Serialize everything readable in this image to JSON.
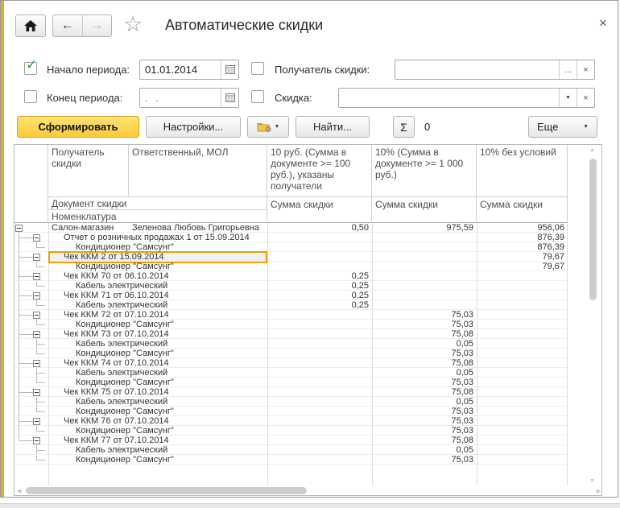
{
  "window": {
    "title": "Автоматические скидки"
  },
  "icons": {
    "check": "✓",
    "back": "←",
    "forward": "→",
    "star": "☆",
    "close": "×",
    "dropdown": "▼",
    "ellipsis": "...",
    "clear": "×",
    "sum": "Σ",
    "gear": "⚙",
    "up": "▲",
    "down": "▼",
    "left": "◀",
    "right": "▶"
  },
  "filters": {
    "start_period": {
      "label": "Начало периода:",
      "value": "01.01.2014",
      "checked": true
    },
    "end_period": {
      "label": "Конец периода:",
      "value": ". .",
      "checked": false
    },
    "recipient": {
      "label": "Получатель скидки:",
      "value": "",
      "checked": false
    },
    "discount": {
      "label": "Скидка:",
      "value": "",
      "checked": false
    }
  },
  "actions": {
    "generate": "Сформировать",
    "settings": "Настройки...",
    "find": "Найти...",
    "sum_value": "0",
    "more": "Еще"
  },
  "colors": {
    "accent_gold": "#dfae2e",
    "generate_button": "#fbca39",
    "selection_border": "#eaa300"
  },
  "table": {
    "header": {
      "col_recipient": "Получатель скидки",
      "col_responsible": "Ответственный, МОЛ",
      "col_10rub": "10 руб. (Сумма в документе >= 100 руб.), указаны получатели",
      "col_10pct": "10% (Сумма в документе >= 1 000 руб.)",
      "col_10nocond": "10% без условий",
      "row_document": "Документ скидки",
      "row_nomenclature": "Номенклатура",
      "sum_label": "Сумма скидки"
    },
    "rows": [
      {
        "level": 1,
        "expander": true,
        "label": "Салон-магазин",
        "responsible": "Зеленова Любовь Григорьевна",
        "v10rub": "0,50",
        "v10pct": "975,59",
        "v10nocond": "956,06"
      },
      {
        "level": 2,
        "expander": true,
        "label": "Отчет о розничных продажах 1 от 15.09.2014",
        "v10nocond": "876,39"
      },
      {
        "level": 3,
        "expander": false,
        "label": "Кондиционер \"Самсунг\"",
        "v10nocond": "876,39"
      },
      {
        "level": 2,
        "expander": true,
        "selected": true,
        "label": "Чек ККМ 2 от 15.09.2014",
        "v10nocond": "79,67"
      },
      {
        "level": 3,
        "expander": false,
        "label": "Кондиционер \"Самсунг\"",
        "v10nocond": "79,67"
      },
      {
        "level": 2,
        "expander": true,
        "label": "Чек ККМ 70 от 06.10.2014",
        "v10rub": "0,25"
      },
      {
        "level": 3,
        "expander": false,
        "label": "Кабель электрический",
        "v10rub": "0,25"
      },
      {
        "level": 2,
        "expander": true,
        "label": "Чек ККМ 71 от 06.10.2014",
        "v10rub": "0,25"
      },
      {
        "level": 3,
        "expander": false,
        "label": "Кабель электрический",
        "v10rub": "0,25"
      },
      {
        "level": 2,
        "expander": true,
        "label": "Чек ККМ 72 от 07.10.2014",
        "v10pct": "75,03"
      },
      {
        "level": 3,
        "expander": false,
        "label": "Кондиционер \"Самсунг\"",
        "v10pct": "75,03"
      },
      {
        "level": 2,
        "expander": true,
        "label": "Чек ККМ 73 от 07.10.2014",
        "v10pct": "75,08"
      },
      {
        "level": 3,
        "expander": false,
        "label": "Кабель электрический",
        "v10pct": "0,05"
      },
      {
        "level": 3,
        "expander": false,
        "label": "Кондиционер \"Самсунг\"",
        "v10pct": "75,03"
      },
      {
        "level": 2,
        "expander": true,
        "label": "Чек ККМ 74 от 07.10.2014",
        "v10pct": "75,08"
      },
      {
        "level": 3,
        "expander": false,
        "label": "Кабель электрический",
        "v10pct": "0,05"
      },
      {
        "level": 3,
        "expander": false,
        "label": "Кондиционер \"Самсунг\"",
        "v10pct": "75,03"
      },
      {
        "level": 2,
        "expander": true,
        "label": "Чек ККМ 75 от 07.10.2014",
        "v10pct": "75,08"
      },
      {
        "level": 3,
        "expander": false,
        "label": "Кабель электрический",
        "v10pct": "0,05"
      },
      {
        "level": 3,
        "expander": false,
        "label": "Кондиционер \"Самсунг\"",
        "v10pct": "75,03"
      },
      {
        "level": 2,
        "expander": true,
        "label": "Чек ККМ 76 от 07.10.2014",
        "v10pct": "75,03"
      },
      {
        "level": 3,
        "expander": false,
        "label": "Кондиционер \"Самсунг\"",
        "v10pct": "75,03"
      },
      {
        "level": 2,
        "expander": true,
        "label": "Чек ККМ 77 от 07.10.2014",
        "v10pct": "75,08"
      },
      {
        "level": 3,
        "expander": false,
        "label": "Кабель электрический",
        "v10pct": "0,05"
      },
      {
        "level": 3,
        "expander": false,
        "label": "Кондиционер \"Самсунг\"",
        "v10pct": "75,03"
      }
    ]
  }
}
